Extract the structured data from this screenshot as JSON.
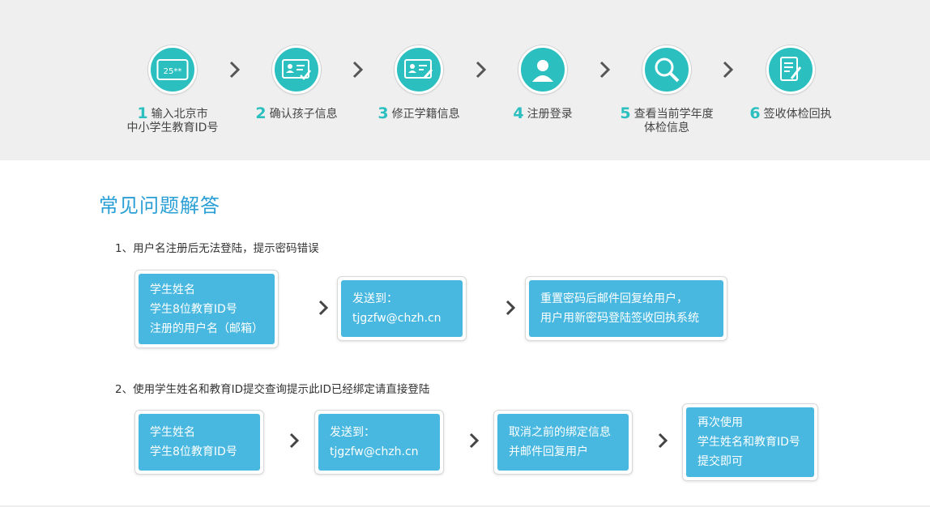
{
  "steps": [
    {
      "num": "1",
      "label_lines": [
        "输入北京市",
        "中小学生教育ID号"
      ],
      "icon": "id-card-icon",
      "icon_text": "25**"
    },
    {
      "num": "2",
      "label_lines": [
        "确认孩子信息"
      ],
      "icon": "profile-check-icon"
    },
    {
      "num": "3",
      "label_lines": [
        "修正学籍信息"
      ],
      "icon": "profile-edit-icon"
    },
    {
      "num": "4",
      "label_lines": [
        "注册登录"
      ],
      "icon": "user-icon"
    },
    {
      "num": "5",
      "label_lines": [
        "查看当前学年度",
        "体检信息"
      ],
      "icon": "search-icon"
    },
    {
      "num": "6",
      "label_lines": [
        "签收体检回执"
      ],
      "icon": "document-sign-icon"
    }
  ],
  "faq": {
    "title": "常见问题解答",
    "questions": [
      {
        "text": "1、用户名注册后无法登陆，提示密码错误",
        "cards": [
          {
            "lines": [
              "学生姓名",
              "学生8位教育ID号",
              "注册的用户名（邮箱）"
            ]
          },
          {
            "lines": [
              "发送到：",
              "tjgzfw@chzh.cn"
            ]
          },
          {
            "lines": [
              "重置密码后邮件回复给用户，",
              "用户用新密码登陆签收回执系统"
            ]
          }
        ]
      },
      {
        "text": "2、使用学生姓名和教育ID提交查询提示此ID已经绑定请直接登陆",
        "cards": [
          {
            "lines": [
              "学生姓名",
              "学生8位教育ID号"
            ]
          },
          {
            "lines": [
              "发送到：",
              "tjgzfw@chzh.cn"
            ]
          },
          {
            "lines": [
              "取消之前的绑定信息",
              "并邮件回复用户"
            ]
          },
          {
            "lines": [
              "再次使用",
              "学生姓名和教育ID号",
              "提交即可"
            ]
          }
        ]
      }
    ]
  },
  "colors": {
    "teal": "#2bbfc0",
    "blue": "#48b8e0",
    "title_blue": "#2a9fd6",
    "band": "#efefef"
  }
}
